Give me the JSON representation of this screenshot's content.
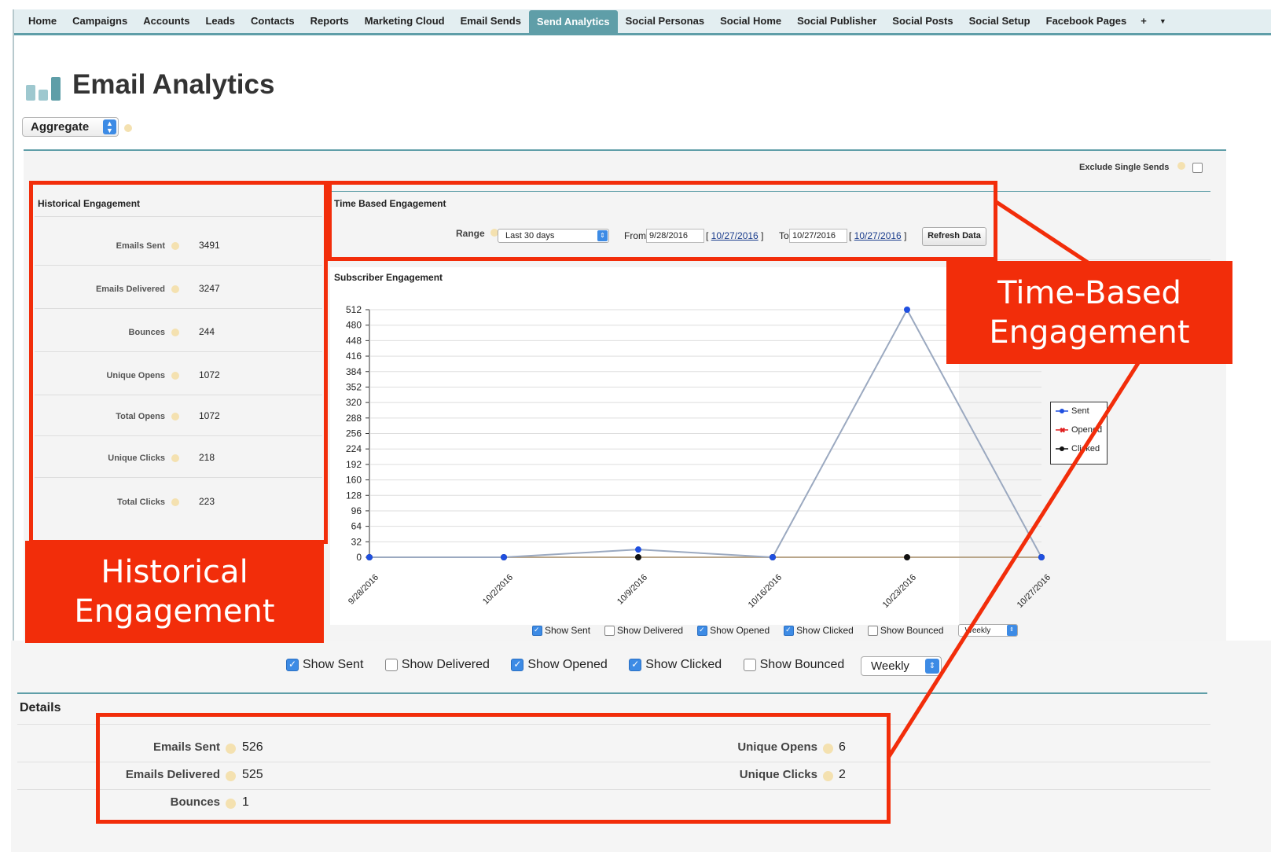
{
  "tabs": [
    "Home",
    "Campaigns",
    "Accounts",
    "Leads",
    "Contacts",
    "Reports",
    "Marketing Cloud",
    "Email Sends",
    "Send Analytics",
    "Social Personas",
    "Social Home",
    "Social Publisher",
    "Social Posts",
    "Social Setup",
    "Facebook Pages"
  ],
  "tab_active": "Send Analytics",
  "tab_plus": "+",
  "tab_more": "▼",
  "page": {
    "title": "Email Analytics",
    "icon": "bar-chart-icon"
  },
  "view_select": "Aggregate",
  "exclude_single_sends": "Exclude Single Sends",
  "historical": {
    "title": "Historical Engagement",
    "rows": [
      {
        "label": "Emails Sent",
        "value": "3491"
      },
      {
        "label": "Emails Delivered",
        "value": "3247"
      },
      {
        "label": "Bounces",
        "value": "244"
      },
      {
        "label": "Unique Opens",
        "value": "1072"
      },
      {
        "label": "Total Opens",
        "value": "1072"
      },
      {
        "label": "Unique Clicks",
        "value": "218"
      },
      {
        "label": "Total Clicks",
        "value": "223"
      }
    ]
  },
  "time_based": {
    "title": "Time Based Engagement",
    "range_label": "Range",
    "range_value": "Last 30 days",
    "from_label": "From",
    "from_value": "9/28/2016",
    "from_link": "10/27/2016",
    "to_label": "To",
    "to_value": "10/27/2016",
    "to_link": "10/27/2016",
    "refresh": "Refresh Data"
  },
  "subscriber": {
    "title": "Subscriber Engagement"
  },
  "chart_data": {
    "type": "line",
    "x": [
      "9/28/2016",
      "10/2/2016",
      "10/9/2016",
      "10/16/2016",
      "10/23/2016",
      "10/27/2016"
    ],
    "series": [
      {
        "name": "Sent",
        "values": [
          0,
          0,
          16,
          0,
          512,
          0
        ],
        "color": "#1f4fe0"
      },
      {
        "name": "Opened",
        "values": [
          0,
          0,
          0,
          0,
          0,
          0
        ],
        "color": "#e02020"
      },
      {
        "name": "Clicked",
        "values": [
          0,
          0,
          0,
          0,
          0,
          0
        ],
        "color": "#111111"
      }
    ],
    "yticks": [
      0,
      32,
      64,
      96,
      128,
      160,
      192,
      224,
      256,
      288,
      320,
      352,
      384,
      416,
      448,
      480,
      512
    ],
    "ylim": [
      0,
      512
    ],
    "grid": true,
    "legend": "right"
  },
  "legend_labels": {
    "sent": "Sent",
    "opened": "Opened",
    "clicked": "Clicked"
  },
  "show_options": [
    {
      "label": "Show Sent",
      "checked": true
    },
    {
      "label": "Show Delivered",
      "checked": false
    },
    {
      "label": "Show Opened",
      "checked": true
    },
    {
      "label": "Show Clicked",
      "checked": true
    },
    {
      "label": "Show Bounced",
      "checked": false
    }
  ],
  "interval": "Weekly",
  "details": {
    "title": "Details",
    "left": [
      {
        "label": "Emails Sent",
        "value": "526"
      },
      {
        "label": "Emails Delivered",
        "value": "525"
      },
      {
        "label": "Bounces",
        "value": "1"
      }
    ],
    "right": [
      {
        "label": "Unique Opens",
        "value": "6"
      },
      {
        "label": "Unique Clicks",
        "value": "2"
      }
    ]
  },
  "callouts": {
    "time_based": [
      "Time-Based",
      "Engagement"
    ],
    "historical": [
      "Historical",
      "Engagement"
    ]
  },
  "colors": {
    "annotation_red": "#f22d0a",
    "teal": "#5f9ea8",
    "select_blue": "#3d8be5"
  }
}
